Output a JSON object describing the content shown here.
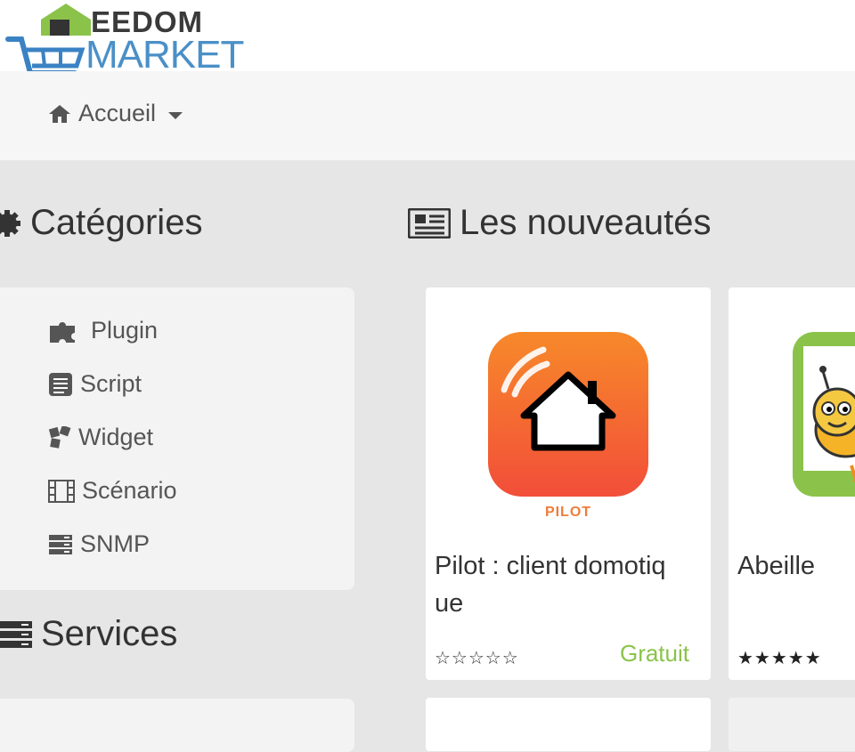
{
  "logo": {
    "top_text": "EEDOM",
    "bottom_text": "MARKET"
  },
  "nav": {
    "home_label": "Accueil"
  },
  "categories": {
    "title": "Catégories",
    "items": [
      {
        "label": "Plugin",
        "icon": "puzzle-icon"
      },
      {
        "label": "Script",
        "icon": "script-icon"
      },
      {
        "label": "Widget",
        "icon": "widget-icon"
      },
      {
        "label": "Scénario",
        "icon": "film-icon"
      },
      {
        "label": "SNMP",
        "icon": "server-icon"
      }
    ]
  },
  "services": {
    "title": "Services"
  },
  "news": {
    "title": "Les nouveautés",
    "cards": [
      {
        "badge": "PILOT",
        "title_line1": "Pilot : client domotiq",
        "title_line2": "ue",
        "stars": "☆☆☆☆☆",
        "price": "Gratuit"
      },
      {
        "title_line1": "Abeille",
        "stars": "★★★★★"
      }
    ]
  },
  "colors": {
    "accent_green": "#8bc34a",
    "pilot_orange": "#f26a35",
    "logo_blue": "#4a90c8"
  }
}
